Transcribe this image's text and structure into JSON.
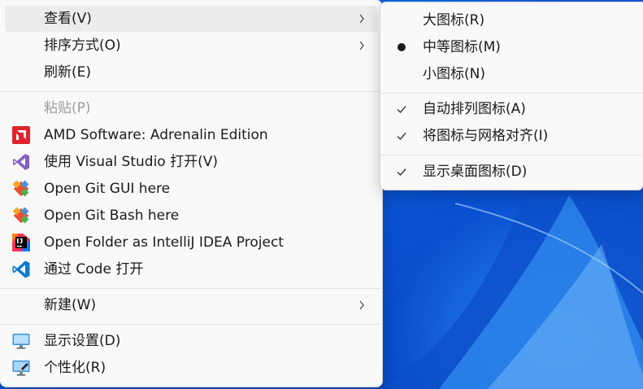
{
  "main_menu": {
    "view": {
      "label": "查看(V)"
    },
    "sort_by": {
      "label": "排序方式(O)"
    },
    "refresh": {
      "label": "刷新(E)"
    },
    "paste": {
      "label": "粘贴(P)"
    },
    "amd_software": {
      "label": "AMD Software: Adrenalin Edition",
      "icon": "amd-icon",
      "color": "#e3232c"
    },
    "open_visual_studio": {
      "label": "使用 Visual Studio 打开(V)",
      "icon": "visual-studio-icon",
      "color": "#865fc5"
    },
    "open_git_gui": {
      "label": "Open Git GUI here",
      "icon": "git-gui-icon"
    },
    "open_git_bash": {
      "label": "Open Git Bash here",
      "icon": "git-bash-icon"
    },
    "open_intellij": {
      "label": "Open Folder as IntelliJ IDEA Project",
      "icon": "intellij-idea-icon"
    },
    "open_vscode": {
      "label": "通过 Code 打开",
      "icon": "vscode-icon",
      "color": "#0a7bd4"
    },
    "new": {
      "label": "新建(W)"
    },
    "display_settings": {
      "label": "显示设置(D)",
      "icon": "display-settings-icon"
    },
    "personalize": {
      "label": "个性化(R)",
      "icon": "personalize-icon"
    }
  },
  "view_submenu": {
    "large_icons": {
      "label": "大图标(R)",
      "selected": false
    },
    "medium_icons": {
      "label": "中等图标(M)",
      "selected": true
    },
    "small_icons": {
      "label": "小图标(N)",
      "selected": false
    },
    "auto_arrange": {
      "label": "自动排列图标(A)",
      "checked": true
    },
    "align_to_grid": {
      "label": "将图标与网格对齐(I)",
      "checked": true
    },
    "show_desktop_icons": {
      "label": "显示桌面图标(D)",
      "checked": true
    }
  },
  "colors": {
    "menu_background": "#f9f9f9",
    "hover_background": "#ececec",
    "disabled_text": "#9e9e9e",
    "desktop_accent": "#0b5fd8"
  }
}
